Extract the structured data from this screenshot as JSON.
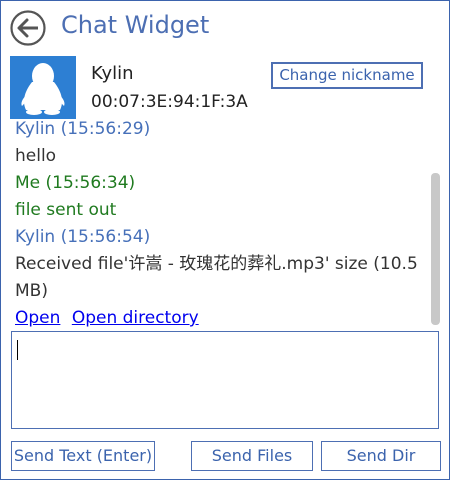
{
  "window": {
    "title": "Chat Widget"
  },
  "contact": {
    "nickname": "Kylin",
    "mac": "00:07:3E:94:1F:3A",
    "change_nickname_label": "Change nickname"
  },
  "messages": [
    {
      "sender": "Kylin",
      "time": "Kylin (15:56:29)",
      "text": "hello"
    },
    {
      "sender": "Me",
      "time": "Me (15:56:34)",
      "text": "file sent out"
    },
    {
      "sender": "Kylin",
      "time": "Kylin (15:56:54)",
      "text": "Received file'许嵩 - 玫瑰花的葬礼.mp3' size (10.5 MB)"
    }
  ],
  "file_links": {
    "open": "Open",
    "open_directory": "Open directory"
  },
  "input": {
    "value": ""
  },
  "buttons": {
    "send_text": "Send Text (Enter)",
    "send_files": "Send Files",
    "send_dir": "Send Dir"
  },
  "colors": {
    "accent": "#4d6fb3",
    "peer_text": "#4670b9",
    "me_text": "#1f7a1f",
    "avatar_bg": "#2d7fd3"
  },
  "icons": {
    "back": "back-arrow-icon",
    "avatar": "penguin-avatar-icon"
  }
}
